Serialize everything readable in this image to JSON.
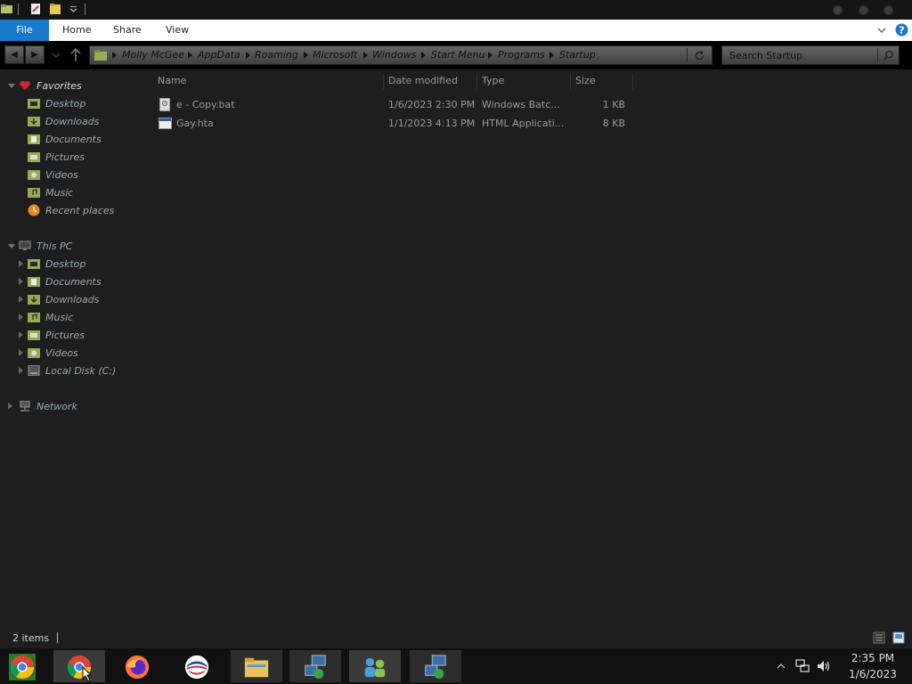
{
  "ribbon": {
    "tabs": [
      "File",
      "Home",
      "Share",
      "View"
    ]
  },
  "address": {
    "crumbs": [
      "Molly McGee",
      "AppData",
      "Roaming",
      "Microsoft",
      "Windows",
      "Start Menu",
      "Programs",
      "Startup"
    ]
  },
  "search": {
    "placeholder": "Search Startup"
  },
  "nav": {
    "favorites": {
      "label": "Favorites",
      "items": [
        {
          "label": "Desktop",
          "icon": "desktop-folder-icon"
        },
        {
          "label": "Downloads",
          "icon": "downloads-folder-icon"
        },
        {
          "label": "Documents",
          "icon": "documents-folder-icon"
        },
        {
          "label": "Pictures",
          "icon": "pictures-folder-icon"
        },
        {
          "label": "Videos",
          "icon": "videos-folder-icon"
        },
        {
          "label": "Music",
          "icon": "music-folder-icon"
        },
        {
          "label": "Recent places",
          "icon": "recent-places-icon"
        }
      ]
    },
    "thispc": {
      "label": "This PC",
      "items": [
        {
          "label": "Desktop"
        },
        {
          "label": "Documents"
        },
        {
          "label": "Downloads"
        },
        {
          "label": "Music"
        },
        {
          "label": "Pictures"
        },
        {
          "label": "Videos"
        },
        {
          "label": "Local Disk (C:)"
        }
      ]
    },
    "network": {
      "label": "Network"
    }
  },
  "columns": {
    "name": "Name",
    "date": "Date modified",
    "type": "Type",
    "size": "Size"
  },
  "files": [
    {
      "name": "e - Copy.bat",
      "date": "1/6/2023 2:30 PM",
      "type": "Windows Batc...",
      "size": "1 KB",
      "icon": "batch-file-icon"
    },
    {
      "name": "Gay.hta",
      "date": "1/1/2023 4:13 PM",
      "type": "HTML Applicati...",
      "size": "8 KB",
      "icon": "hta-file-icon"
    }
  ],
  "status": {
    "count": "2 items"
  },
  "taskbar": {
    "apps": [
      "chrome-icon",
      "chrome-icon",
      "firefox-icon",
      "opera-icon",
      "file-explorer-icon",
      "network-setup-icon",
      "people-icon",
      "network-setup-icon"
    ]
  },
  "clock": {
    "time": "2:35 PM",
    "date": "1/6/2023"
  },
  "colors": {
    "accent": "#1979ca",
    "background": "#1e1e1e",
    "address_bar": "#000000"
  }
}
